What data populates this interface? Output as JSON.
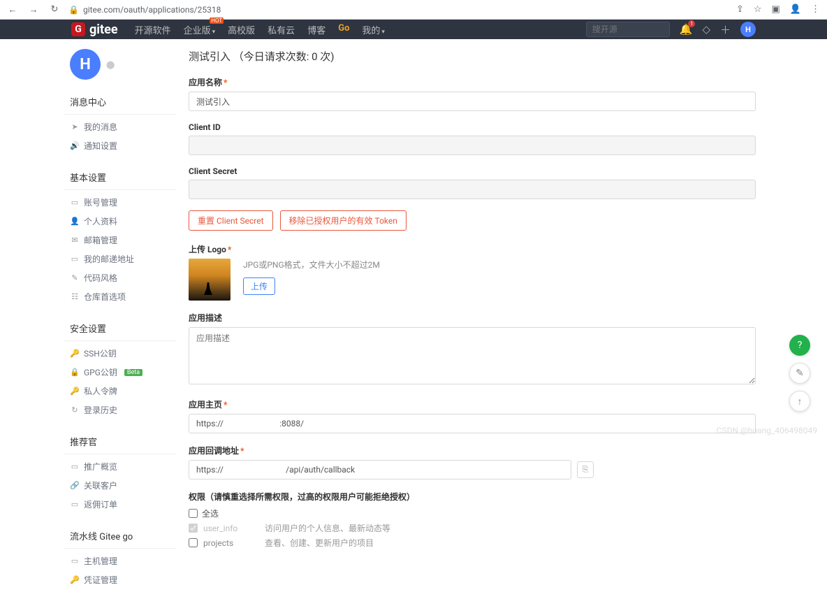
{
  "browser": {
    "url": "gitee.com/oauth/applications/25318"
  },
  "nav": {
    "logo_text": "gitee",
    "links": [
      "开源软件",
      "企业版",
      "高校版",
      "私有云",
      "博客",
      "Go",
      "我的"
    ],
    "badge_on": 1,
    "search_placeholder": "搜开源",
    "notif_count": "1",
    "avatar_letter": "H"
  },
  "user": {
    "avatar_letter": "H"
  },
  "sidebar": {
    "groups": [
      {
        "title": "消息中心",
        "items": [
          {
            "icon": "➤",
            "label": "我的消息"
          },
          {
            "icon": "🔊",
            "label": "通知设置"
          }
        ]
      },
      {
        "title": "基本设置",
        "items": [
          {
            "icon": "▭",
            "label": "账号管理"
          },
          {
            "icon": "👤",
            "label": "个人资料"
          },
          {
            "icon": "✉",
            "label": "邮箱管理"
          },
          {
            "icon": "▭",
            "label": "我的邮递地址"
          },
          {
            "icon": "✎",
            "label": "代码风格"
          },
          {
            "icon": "☷",
            "label": "仓库首选项"
          }
        ]
      },
      {
        "title": "安全设置",
        "items": [
          {
            "icon": "🔑",
            "label": "SSH公钥"
          },
          {
            "icon": "🔒",
            "label": "GPG公钥",
            "badge": "Beta"
          },
          {
            "icon": "🔑",
            "label": "私人令牌"
          },
          {
            "icon": "↻",
            "label": "登录历史"
          }
        ]
      },
      {
        "title": "推荐官",
        "items": [
          {
            "icon": "▭",
            "label": "推广概览"
          },
          {
            "icon": "🔗",
            "label": "关联客户"
          },
          {
            "icon": "▭",
            "label": "返佣订单"
          }
        ]
      },
      {
        "title": "流水线 Gitee go",
        "items": [
          {
            "icon": "▭",
            "label": "主机管理"
          },
          {
            "icon": "🔑",
            "label": "凭证管理"
          }
        ]
      }
    ]
  },
  "form": {
    "title": "测试引入  （今日请求次数: 0 次)",
    "name_label": "应用名称",
    "name_value": "测试引入",
    "client_id_label": "Client ID",
    "client_id_value": "",
    "client_secret_label": "Client Secret",
    "client_secret_value": "",
    "reset_secret_btn": "重置 Client Secret",
    "revoke_token_btn": "移除已授权用户的有效 Token",
    "logo_label": "上传 Logo",
    "logo_hint": "JPG或PNG格式，文件大小不超过2M",
    "upload_btn": "上传",
    "desc_label": "应用描述",
    "desc_placeholder": "应用描述",
    "homepage_label": "应用主页",
    "homepage_value": "https://                           :8088/",
    "callback_label": "应用回调地址",
    "callback_value": "https://                              /api/auth/callback",
    "perm_label": "权限（请慎重选择所需权限，过高的权限用户可能拒绝授权）",
    "select_all": "全选",
    "perms": [
      {
        "name": "user_info",
        "desc": "访问用户的个人信息、最新动态等",
        "locked": true
      },
      {
        "name": "projects",
        "desc": "查看、创建、更新用户的项目",
        "locked": false
      }
    ]
  },
  "watermark": "CSDN @huang_406498049"
}
